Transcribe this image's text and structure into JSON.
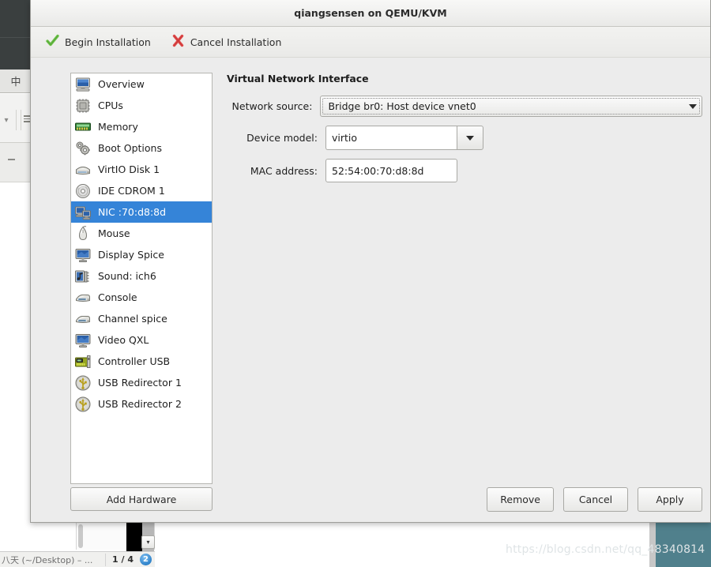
{
  "window": {
    "title": "qiangsensen on QEMU/KVM"
  },
  "toolbar": {
    "begin_label": "Begin Installation",
    "cancel_label": "Cancel Installation",
    "begin_icon": "green-check-icon",
    "cancel_icon": "red-x-icon"
  },
  "sidebar": {
    "items": [
      {
        "label": "Overview",
        "icon": "monitor-icon",
        "selected": false
      },
      {
        "label": "CPUs",
        "icon": "cpu-chip-icon",
        "selected": false
      },
      {
        "label": "Memory",
        "icon": "memory-stick-icon",
        "selected": false
      },
      {
        "label": "Boot Options",
        "icon": "gears-icon",
        "selected": false
      },
      {
        "label": "VirtIO Disk 1",
        "icon": "harddisk-icon",
        "selected": false
      },
      {
        "label": "IDE CDROM 1",
        "icon": "cdrom-icon",
        "selected": false
      },
      {
        "label": "NIC :70:d8:8d",
        "icon": "network-card-icon",
        "selected": true
      },
      {
        "label": "Mouse",
        "icon": "mouse-icon",
        "selected": false
      },
      {
        "label": "Display Spice",
        "icon": "display-icon",
        "selected": false
      },
      {
        "label": "Sound: ich6",
        "icon": "sound-icon",
        "selected": false
      },
      {
        "label": "Console",
        "icon": "console-icon",
        "selected": false
      },
      {
        "label": "Channel spice",
        "icon": "console-icon",
        "selected": false
      },
      {
        "label": "Video QXL",
        "icon": "display-icon",
        "selected": false
      },
      {
        "label": "Controller USB",
        "icon": "pci-card-icon",
        "selected": false
      },
      {
        "label": "USB Redirector 1",
        "icon": "usb-icon",
        "selected": false
      },
      {
        "label": "USB Redirector 2",
        "icon": "usb-icon",
        "selected": false
      }
    ],
    "add_hardware_label": "Add Hardware"
  },
  "panel": {
    "title": "Virtual Network Interface",
    "fields": {
      "network_source": {
        "label": "Network source:",
        "value": "Bridge br0: Host device vnet0"
      },
      "device_model": {
        "label": "Device model:",
        "value": "virtio"
      },
      "mac_address": {
        "label": "MAC address:",
        "value": "52:54:00:70:d8:8d"
      }
    }
  },
  "actions": {
    "remove_label": "Remove",
    "cancel_label": "Cancel",
    "apply_label": "Apply"
  },
  "desktop": {
    "ime_indicator": "中",
    "watermark": "https://blog.csdn.net/qq_48340814",
    "taskbar": {
      "window_title": "八天 (~/Desktop) – ...",
      "page_counter": "1 / 4",
      "badge_count": "2"
    }
  },
  "colors": {
    "selection_blue": "#3584d8",
    "panel_bg": "#ececec",
    "dark_panel": "#3a3f3f",
    "teal": "#50808c"
  }
}
